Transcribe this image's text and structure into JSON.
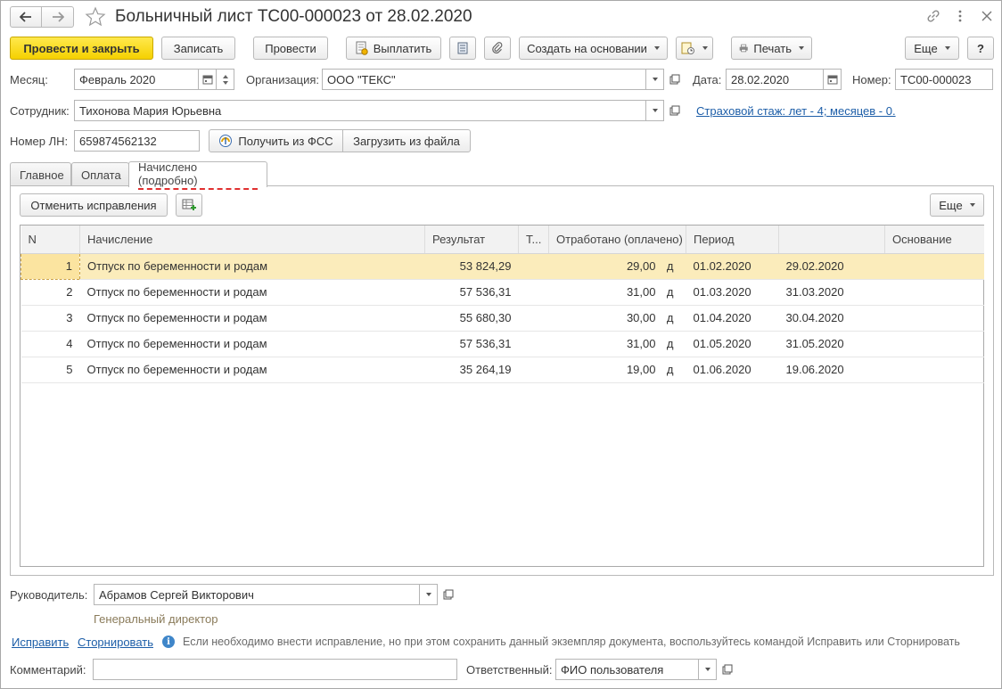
{
  "window": {
    "title": "Больничный лист ТС00-000023 от 28.02.2020"
  },
  "toolbar": {
    "post_close": "Провести и закрыть",
    "save": "Записать",
    "post": "Провести",
    "pay": "Выплатить",
    "create_based": "Создать на основании",
    "print": "Печать",
    "more": "Еще",
    "help": "?"
  },
  "form": {
    "month_label": "Месяц:",
    "month_value": "Февраль 2020",
    "org_label": "Организация:",
    "org_value": "ООО \"ТЕКС\"",
    "date_label": "Дата:",
    "date_value": "28.02.2020",
    "number_label": "Номер:",
    "number_value": "ТС00-000023",
    "employee_label": "Сотрудник:",
    "employee_value": "Тихонова Мария Юрьевна",
    "insurance_link": "Страховой стаж: лет - 4; месяцев - 0.",
    "ln_label": "Номер ЛН:",
    "ln_value": "659874562132",
    "get_fss": "Получить из ФСС",
    "load_file": "Загрузить из файла"
  },
  "tabs": [
    {
      "label": "Главное"
    },
    {
      "label": "Оплата"
    },
    {
      "label": "Начислено (подробно)"
    }
  ],
  "panel": {
    "cancel_fix": "Отменить исправления",
    "more": "Еще"
  },
  "table": {
    "headers": [
      "N",
      "Начисление",
      "Результат",
      "Т...",
      "Отработано (оплачено)",
      "Период",
      "",
      "Основание"
    ],
    "rows": [
      {
        "n": "1",
        "accrual": "Отпуск по беременности и родам",
        "result": "53 824,29",
        "t": "",
        "worked": "29,00",
        "unit": "д",
        "from": "01.02.2020",
        "to": "29.02.2020",
        "basis": ""
      },
      {
        "n": "2",
        "accrual": "Отпуск по беременности и родам",
        "result": "57 536,31",
        "t": "",
        "worked": "31,00",
        "unit": "д",
        "from": "01.03.2020",
        "to": "31.03.2020",
        "basis": ""
      },
      {
        "n": "3",
        "accrual": "Отпуск по беременности и родам",
        "result": "55 680,30",
        "t": "",
        "worked": "30,00",
        "unit": "д",
        "from": "01.04.2020",
        "to": "30.04.2020",
        "basis": ""
      },
      {
        "n": "4",
        "accrual": "Отпуск по беременности и родам",
        "result": "57 536,31",
        "t": "",
        "worked": "31,00",
        "unit": "д",
        "from": "01.05.2020",
        "to": "31.05.2020",
        "basis": ""
      },
      {
        "n": "5",
        "accrual": "Отпуск по беременности и родам",
        "result": "35 264,19",
        "t": "",
        "worked": "19,00",
        "unit": "д",
        "from": "01.06.2020",
        "to": "19.06.2020",
        "basis": ""
      }
    ]
  },
  "footer": {
    "head_label": "Руководитель:",
    "head_value": "Абрамов Сергей Викторович",
    "head_position": "Генеральный директор",
    "fix_link": "Исправить",
    "storno_link": "Сторнировать",
    "info_text": "Если необходимо внести исправление, но при этом сохранить данный экземпляр документа, воспользуйтесь командой Исправить или Сторнировать",
    "comment_label": "Комментарий:",
    "comment_value": "",
    "responsible_label": "Ответственный:",
    "responsible_value": "ФИО пользователя"
  }
}
